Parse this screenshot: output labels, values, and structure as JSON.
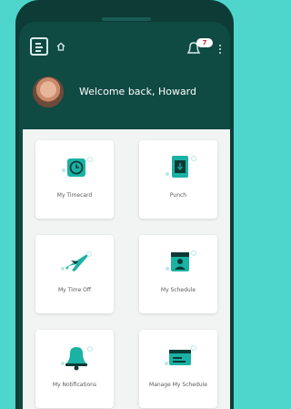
{
  "header": {
    "notification_count": "7"
  },
  "welcome": {
    "text": "Welcome back, Howard"
  },
  "tiles": [
    {
      "label": "My Timecard",
      "icon": "clock-icon"
    },
    {
      "label": "Punch",
      "icon": "punch-clock-icon"
    },
    {
      "label": "My Time Off",
      "icon": "airplane-icon"
    },
    {
      "label": "My Schedule",
      "icon": "schedule-icon"
    },
    {
      "label": "My Notifications",
      "icon": "bell-icon"
    },
    {
      "label": "Manage My Schedule",
      "icon": "manage-schedule-icon"
    }
  ],
  "colors": {
    "background": "#4fd6cc",
    "header": "#0f4a43",
    "accent": "#1ab2a4",
    "badge": "#c9283a"
  }
}
